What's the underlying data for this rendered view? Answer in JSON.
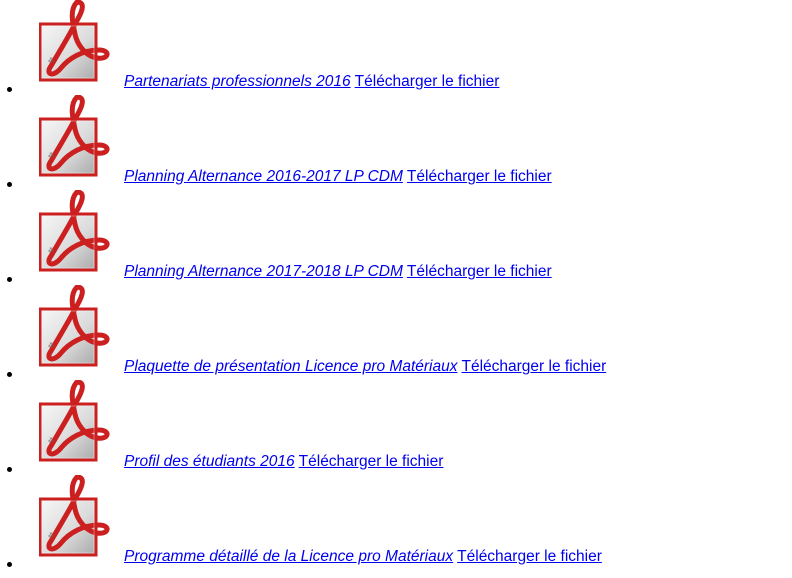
{
  "files": [
    {
      "title": "Partenariats professionnels 2016",
      "download_label": "Télécharger le fichier",
      "icon": "pdf-icon"
    },
    {
      "title": "Planning Alternance 2016-2017 LP CDM",
      "download_label": "Télécharger le fichier",
      "icon": "pdf-icon"
    },
    {
      "title": "Planning Alternance 2017-2018 LP CDM",
      "download_label": "Télécharger le fichier",
      "icon": "pdf-icon"
    },
    {
      "title": "Plaquette de présentation Licence pro Matériaux",
      "download_label": "Télécharger le fichier",
      "icon": "pdf-icon"
    },
    {
      "title": "Profil des étudiants 2016",
      "download_label": "Télécharger le fichier",
      "icon": "pdf-icon"
    },
    {
      "title": "Programme détaillé de la Licence pro Matériaux",
      "download_label": "Télécharger le fichier",
      "icon": "pdf-icon"
    }
  ],
  "colors": {
    "link": "#0000ee",
    "pdf_red": "#cc1f1f",
    "icon_frame": "#c8c8c8"
  }
}
